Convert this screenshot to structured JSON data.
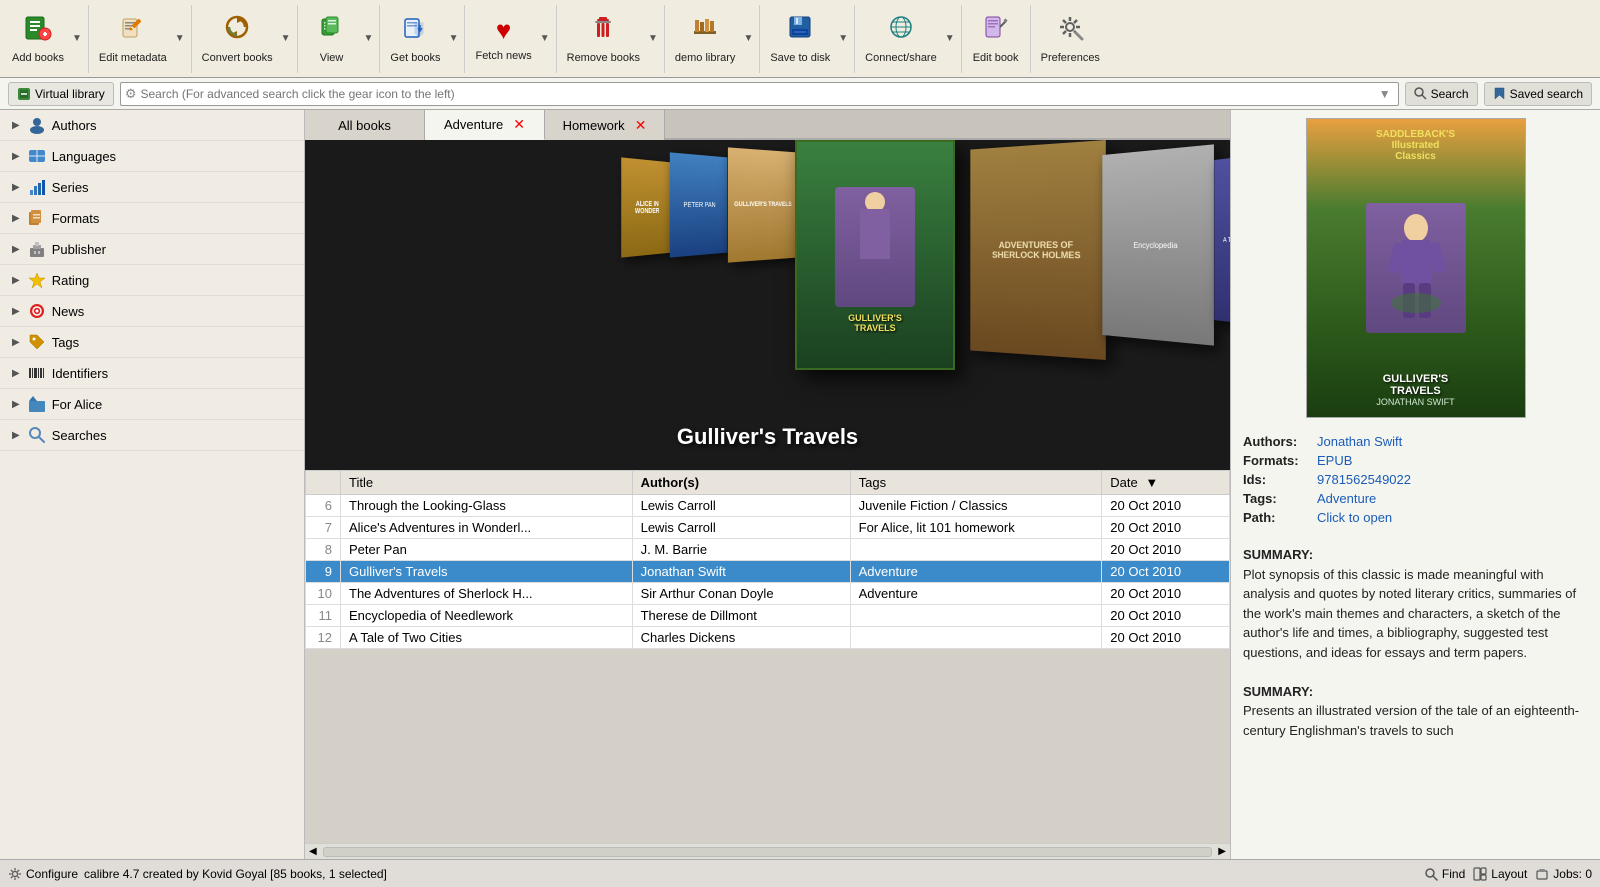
{
  "toolbar": {
    "buttons": [
      {
        "id": "add-books",
        "icon": "➕",
        "label": "Add books",
        "color": "#2a8a2a",
        "hasDropdown": true
      },
      {
        "id": "edit-metadata",
        "icon": "✏️",
        "label": "Edit metadata",
        "color": "#e07800",
        "hasDropdown": true
      },
      {
        "id": "convert-books",
        "icon": "🔄",
        "label": "Convert books",
        "color": "#a06000",
        "hasDropdown": true
      },
      {
        "id": "view",
        "icon": "👁️",
        "label": "View",
        "color": "#3a9a3a",
        "hasDropdown": true
      },
      {
        "id": "get-books",
        "icon": "📥",
        "label": "Get books",
        "color": "#2060c0",
        "hasDropdown": true
      },
      {
        "id": "fetch-news",
        "icon": "❤️",
        "label": "Fetch news",
        "color": "#cc0000",
        "hasDropdown": true
      },
      {
        "id": "remove-books",
        "icon": "🗑️",
        "label": "Remove books",
        "color": "#cc2020",
        "hasDropdown": true
      },
      {
        "id": "demo-library",
        "icon": "📚",
        "label": "demo library",
        "color": "#806020",
        "hasDropdown": true
      },
      {
        "id": "save-to-disk",
        "icon": "💾",
        "label": "Save to disk",
        "color": "#2060a0",
        "hasDropdown": true
      },
      {
        "id": "connect-share",
        "icon": "🌐",
        "label": "Connect/share",
        "color": "#1a8080",
        "hasDropdown": true
      },
      {
        "id": "edit-book",
        "icon": "📖",
        "label": "Edit book",
        "color": "#8040a0",
        "hasDropdown": false
      },
      {
        "id": "preferences",
        "icon": "🔧",
        "label": "Preferences",
        "color": "#606060",
        "hasDropdown": false
      }
    ]
  },
  "searchbar": {
    "virtual_library_label": "Virtual library",
    "search_placeholder": "Search (For advanced search click the gear icon to the left)",
    "search_label": "Search",
    "saved_search_label": "Saved search"
  },
  "tabs": [
    {
      "id": "all-books",
      "label": "All books",
      "closeable": false,
      "active": false
    },
    {
      "id": "adventure",
      "label": "Adventure",
      "closeable": true,
      "active": true
    },
    {
      "id": "homework",
      "label": "Homework",
      "closeable": true,
      "active": false
    }
  ],
  "sidebar": {
    "items": [
      {
        "id": "authors",
        "icon": "👤",
        "label": "Authors"
      },
      {
        "id": "languages",
        "icon": "🔤",
        "label": "Languages"
      },
      {
        "id": "series",
        "icon": "📊",
        "label": "Series"
      },
      {
        "id": "formats",
        "icon": "📦",
        "label": "Formats"
      },
      {
        "id": "publisher",
        "icon": "🏢",
        "label": "Publisher"
      },
      {
        "id": "rating",
        "icon": "⭐",
        "label": "Rating"
      },
      {
        "id": "news",
        "icon": "🔴",
        "label": "News"
      },
      {
        "id": "tags",
        "icon": "🏷️",
        "label": "Tags"
      },
      {
        "id": "identifiers",
        "icon": "🔢",
        "label": "Identifiers"
      },
      {
        "id": "for-alice",
        "icon": "📁",
        "label": "For Alice"
      },
      {
        "id": "searches",
        "icon": "🔍",
        "label": "Searches"
      }
    ]
  },
  "cover_display": {
    "title": "Gulliver's Travels"
  },
  "table": {
    "columns": [
      {
        "id": "title",
        "label": "Title",
        "bold": false
      },
      {
        "id": "authors",
        "label": "Author(s)",
        "bold": true
      },
      {
        "id": "tags",
        "label": "Tags",
        "bold": false
      },
      {
        "id": "date",
        "label": "Date",
        "bold": false,
        "sorted": true,
        "sort_dir": "desc"
      }
    ],
    "rows": [
      {
        "num": "6",
        "title": "Through the Looking-Glass",
        "authors": "Lewis Carroll",
        "tags": "Juvenile Fiction / Classics",
        "date": "20 Oct 2010",
        "selected": false
      },
      {
        "num": "7",
        "title": "Alice's Adventures in Wonderl...",
        "authors": "Lewis Carroll",
        "tags": "For Alice, lit 101 homework",
        "date": "20 Oct 2010",
        "selected": false
      },
      {
        "num": "8",
        "title": "Peter Pan",
        "authors": "J. M. Barrie",
        "tags": "",
        "date": "20 Oct 2010",
        "selected": false
      },
      {
        "num": "9",
        "title": "Gulliver's Travels",
        "authors": "Jonathan Swift",
        "tags": "Adventure",
        "date": "20 Oct 2010",
        "selected": true
      },
      {
        "num": "10",
        "title": "The Adventures of Sherlock H...",
        "authors": "Sir Arthur Conan Doyle",
        "tags": "Adventure",
        "date": "20 Oct 2010",
        "selected": false
      },
      {
        "num": "11",
        "title": "Encyclopedia of Needlework",
        "authors": "Therese de Dillmont",
        "tags": "",
        "date": "20 Oct 2010",
        "selected": false
      },
      {
        "num": "12",
        "title": "A Tale of Two Cities",
        "authors": "Charles Dickens",
        "tags": "",
        "date": "20 Oct 2010",
        "selected": false
      }
    ]
  },
  "detail": {
    "authors_label": "Authors:",
    "authors_value": "Jonathan Swift",
    "formats_label": "Formats:",
    "formats_value": "EPUB",
    "ids_label": "Ids:",
    "ids_value": "9781562549022",
    "tags_label": "Tags:",
    "tags_value": "Adventure",
    "path_label": "Path:",
    "path_value": "Click to open",
    "summary_label": "SUMMARY:",
    "summary_text": "Plot synopsis of this classic is made meaningful with analysis and quotes by noted literary critics, summaries of the work's main themes and characters, a sketch of the author's life and times, a bibliography, suggested test questions, and ideas for essays and term papers.",
    "summary_label2": "SUMMARY:",
    "summary_text2": "Presents an illustrated version of the tale of an eighteenth-century Englishman's travels to such"
  },
  "statusbar": {
    "configure_label": "Configure",
    "find_label": "Find",
    "status_text": "calibre 4.7 created by Kovid Goyal    [85 books, 1 selected]",
    "layout_label": "Layout",
    "jobs_label": "Jobs: 0"
  }
}
